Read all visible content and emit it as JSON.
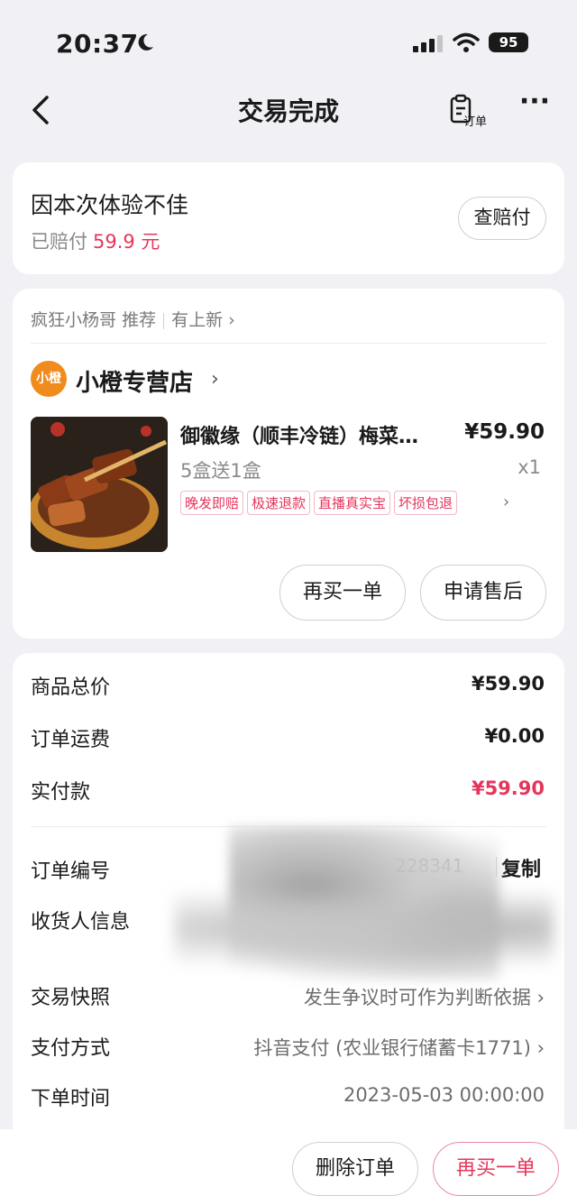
{
  "status": {
    "time": "20:37",
    "battery": "95"
  },
  "nav": {
    "title": "交易完成",
    "order_label": "订单"
  },
  "compensation": {
    "title": "因本次体验不佳",
    "paid_label": "已赔付",
    "paid_amount": "59.9 元",
    "check_button": "查赔付"
  },
  "recommend": {
    "user": "疯狂小杨哥",
    "action": "推荐",
    "tag": "有上新 ›"
  },
  "shop": {
    "logo_text": "小橙",
    "name": "小橙专营店",
    "chevron": "›"
  },
  "product": {
    "title": "御徽缘（顺丰冷链）梅菜…",
    "price": "¥59.90",
    "spec": "5盒送1盒",
    "qty": "x1",
    "tags": [
      "晚发即赔",
      "极速退款",
      "直播真实宝",
      "坏损包退"
    ]
  },
  "actions": {
    "rebuy": "再买一单",
    "after_sale": "申请售后"
  },
  "details": {
    "goods_total_label": "商品总价",
    "goods_total": "¥59.90",
    "shipping_label": "订单运费",
    "shipping": "¥0.00",
    "paid_label": "实付款",
    "paid": "¥59.90",
    "order_no_label": "订单编号",
    "order_no": "228341",
    "copy": "复制",
    "receiver_label": "收货人信息",
    "snapshot_label": "交易快照",
    "snapshot_value": "发生争议时可作为判断依据 ›",
    "payment_label": "支付方式",
    "payment_value": "抖音支付 (农业银行储蓄卡1771) ›",
    "time_label": "下单时间",
    "time_value": "2023-05-03 00:00:00"
  },
  "bottom": {
    "delete": "删除订单",
    "rebuy": "再买一单"
  },
  "colors": {
    "accent": "#e4365c",
    "background": "#f1f1f5",
    "shop_logo": "#f08b1d"
  }
}
